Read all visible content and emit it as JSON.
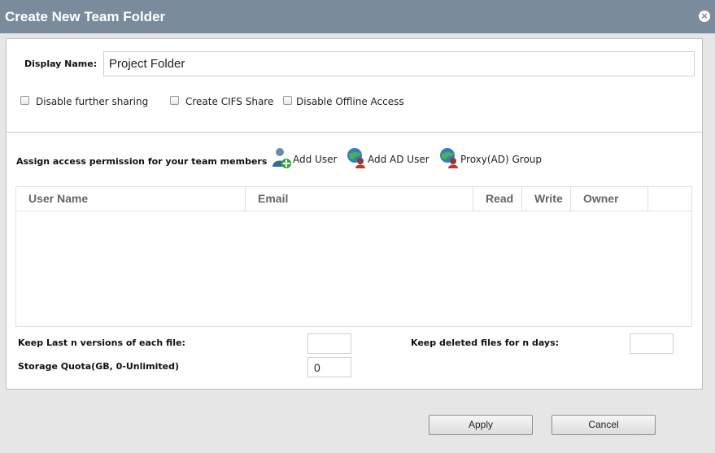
{
  "dialog": {
    "title": "Create New Team Folder",
    "close_symbol": "×"
  },
  "display_name": {
    "label": "Display Name:",
    "value": "Project Folder"
  },
  "options": [
    {
      "label": "Disable further sharing",
      "checked": false
    },
    {
      "label": "Create CIFS Share",
      "checked": false
    },
    {
      "label": "Disable Offline Access",
      "checked": false
    }
  ],
  "permissions": {
    "label": "Assign access permission for your team members",
    "actions": [
      {
        "label": "Add User",
        "icon": "add-user-icon"
      },
      {
        "label": "Add AD User",
        "icon": "ad-user-icon"
      },
      {
        "label": "Proxy(AD) Group",
        "icon": "proxy-group-icon"
      }
    ]
  },
  "table": {
    "columns": [
      "User Name",
      "Email",
      "Read",
      "Write",
      "Owner"
    ],
    "rows": []
  },
  "settings": {
    "versions_label": "Keep Last n versions of each file:",
    "versions_value": "",
    "quota_label": "Storage Quota(GB, 0-Unlimited)",
    "quota_value": "0",
    "deleted_label": "Keep deleted files for n days:",
    "deleted_value": ""
  },
  "buttons": {
    "apply": "Apply",
    "cancel": "Cancel"
  },
  "colors": {
    "titlebar": "#7a8c9c",
    "footer": "#e6e6e6"
  }
}
